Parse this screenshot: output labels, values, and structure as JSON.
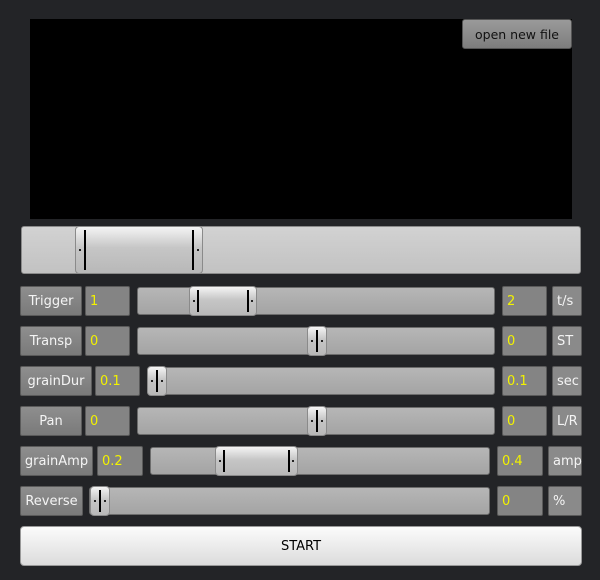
{
  "waveform": {
    "open_file_label": "open new file"
  },
  "rows": [
    {
      "label": "Trigger",
      "min_value": "1",
      "max_value": "2",
      "unit": "t/s"
    },
    {
      "label": "Transp",
      "min_value": "0",
      "max_value": "0",
      "unit": "ST"
    },
    {
      "label": "grainDur",
      "min_value": "0.1",
      "max_value": "0.1",
      "unit": "sec"
    },
    {
      "label": "Pan",
      "min_value": "0",
      "max_value": "0",
      "unit": "L/R"
    },
    {
      "label": "grainAmp",
      "min_value": "0.2",
      "max_value": "0.4",
      "unit": "amp"
    },
    {
      "label": "Reverse",
      "max_value": "0",
      "unit": "%"
    }
  ],
  "start_label": "START"
}
